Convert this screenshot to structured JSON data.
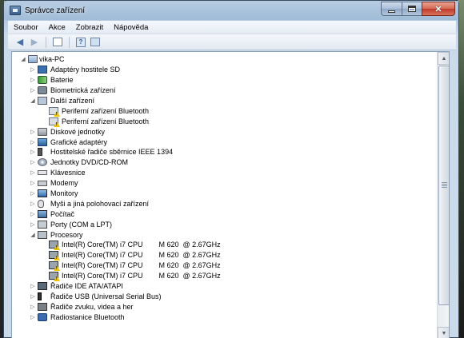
{
  "window": {
    "title": "Správce zařízení",
    "controls": {
      "minimize": "minimize",
      "maximize": "maximize",
      "close": "✕"
    }
  },
  "menu": [
    "Soubor",
    "Akce",
    "Zobrazit",
    "Nápověda"
  ],
  "toolbar": {
    "buttons": [
      "back-arrow-icon",
      "forward-arrow-icon",
      "properties-icon",
      "help-icon",
      "scan-hardware-icon"
    ]
  },
  "tree": {
    "root": "vika-PC",
    "items": [
      {
        "label": "Adaptéry hostitele SD",
        "icon": "sd-host-icon",
        "expanded": false
      },
      {
        "label": "Baterie",
        "icon": "battery-icon",
        "expanded": false
      },
      {
        "label": "Biometrická zařízení",
        "icon": "biometric-icon",
        "expanded": false
      },
      {
        "label": "Další zařízení",
        "icon": "other-devices-icon",
        "expanded": true,
        "children": [
          {
            "label": "Periferní zařízení Bluetooth",
            "icon": "bluetooth-warning-icon"
          },
          {
            "label": "Periferní zařízení Bluetooth",
            "icon": "bluetooth-warning-icon"
          }
        ]
      },
      {
        "label": "Diskové jednotky",
        "icon": "disk-drive-icon",
        "expanded": false
      },
      {
        "label": "Grafické adaptéry",
        "icon": "display-adapter-icon",
        "expanded": false
      },
      {
        "label": "Hostitelské řadiče sběrnice IEEE 1394",
        "icon": "ieee1394-icon",
        "expanded": false
      },
      {
        "label": "Jednotky DVD/CD-ROM",
        "icon": "dvd-icon",
        "expanded": false
      },
      {
        "label": "Klávesnice",
        "icon": "keyboard-icon",
        "expanded": false
      },
      {
        "label": "Modemy",
        "icon": "modem-icon",
        "expanded": false
      },
      {
        "label": "Monitory",
        "icon": "monitor-icon",
        "expanded": false
      },
      {
        "label": "Myši a jiná polohovací zařízení",
        "icon": "mouse-icon",
        "expanded": false
      },
      {
        "label": "Počítač",
        "icon": "computer-icon",
        "expanded": false
      },
      {
        "label": "Porty (COM a LPT)",
        "icon": "ports-icon",
        "expanded": false
      },
      {
        "label": "Procesory",
        "icon": "processor-icon",
        "expanded": true,
        "children": [
          {
            "label": "Intel(R) Core(TM) i7 CPU        M 620  @ 2.67GHz",
            "icon": "cpu-warning-icon"
          },
          {
            "label": "Intel(R) Core(TM) i7 CPU        M 620  @ 2.67GHz",
            "icon": "cpu-warning-icon"
          },
          {
            "label": "Intel(R) Core(TM) i7 CPU        M 620  @ 2.67GHz",
            "icon": "cpu-warning-icon"
          },
          {
            "label": "Intel(R) Core(TM) i7 CPU        M 620  @ 2.67GHz",
            "icon": "cpu-warning-icon"
          }
        ]
      },
      {
        "label": "Řadiče IDE ATA/ATAPI",
        "icon": "ide-controller-icon",
        "expanded": false
      },
      {
        "label": "Řadiče USB (Universal Serial Bus)",
        "icon": "usb-icon",
        "expanded": false
      },
      {
        "label": "Řadiče zvuku, videa a her",
        "icon": "sound-icon",
        "expanded": false
      },
      {
        "label": "Radiostanice Bluetooth",
        "icon": "bluetooth-radio-icon",
        "expanded": false
      }
    ]
  },
  "colors": {
    "window_frame": "#c9daeb",
    "close_button": "#c0392b",
    "warning": "#f2c200",
    "content_bg": "#ffffff"
  }
}
